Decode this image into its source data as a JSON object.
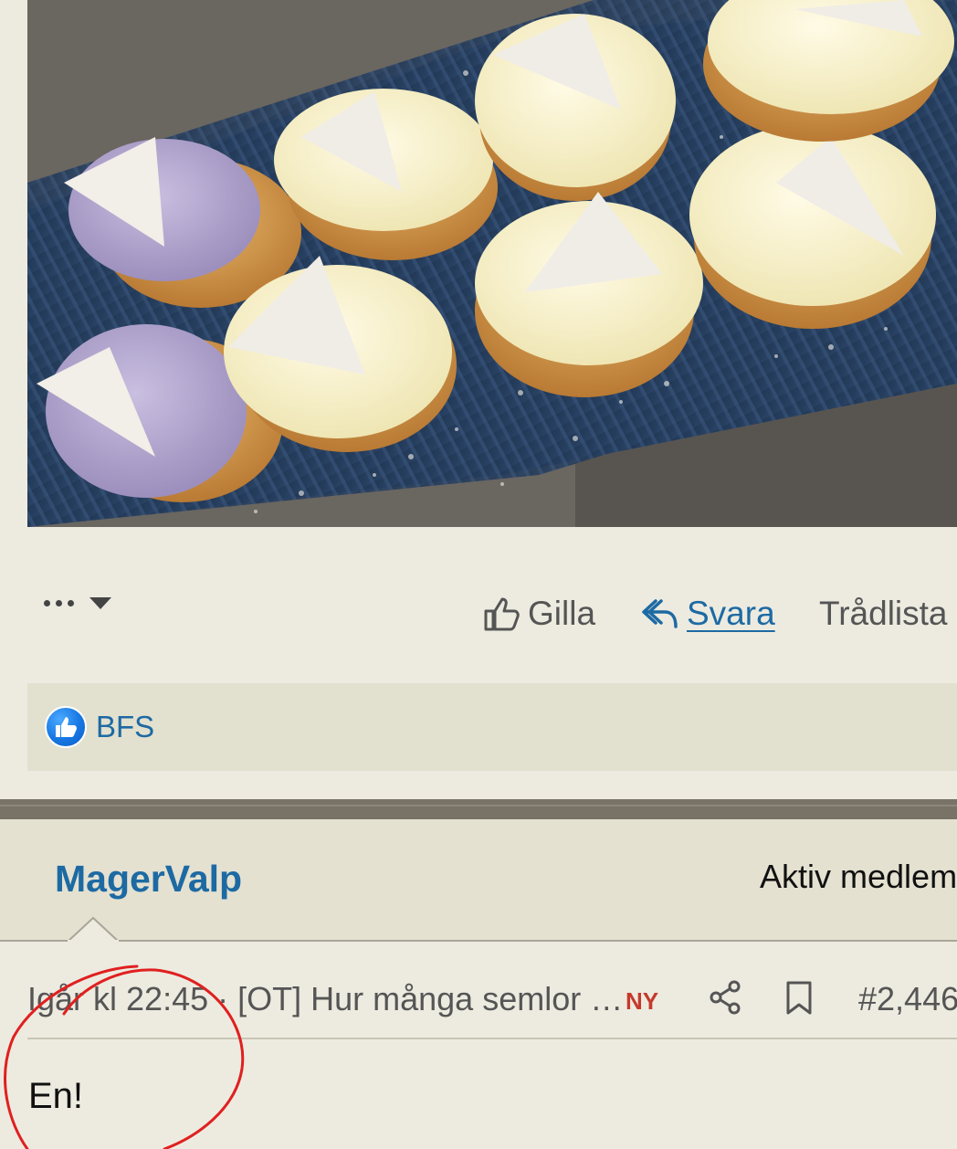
{
  "post": {
    "image_alt_subject": "semlor-photo",
    "actions": {
      "like_label": "Gilla",
      "reply_label": "Svara",
      "thread_label": "Trådlista"
    },
    "reactions": {
      "users": "BFS"
    }
  },
  "next_post": {
    "username": "MagerValp",
    "user_title": "Aktiv medlem",
    "timestamp": "Igår kl 22:45",
    "thread_title": "[OT] Hur många semlor …",
    "meta_separator": " · ",
    "new_badge": "NY",
    "post_number": "#2,446",
    "body": "En!"
  },
  "colors": {
    "background": "#edebe0",
    "link_blue": "#1d6aa3",
    "new_badge_red": "#c53a2c",
    "annotation_red": "#e02020"
  }
}
